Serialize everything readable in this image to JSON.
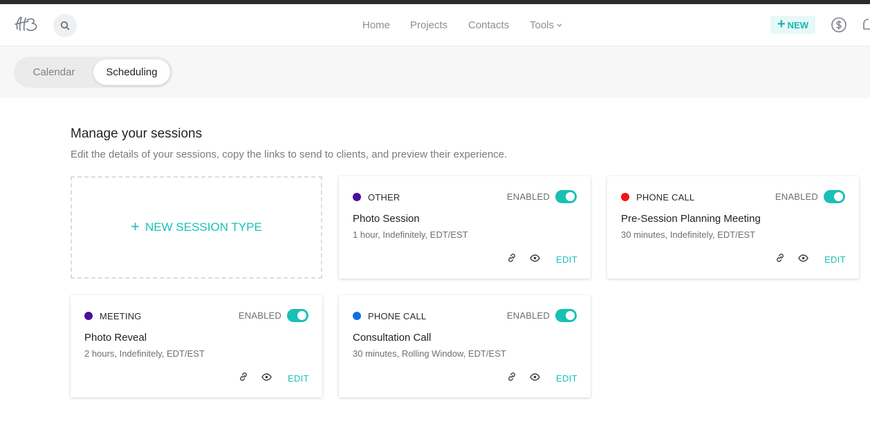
{
  "header": {
    "nav": {
      "home": "Home",
      "projects": "Projects",
      "contacts": "Contacts",
      "tools": "Tools"
    },
    "new_button": "NEW",
    "accent_color": "#19c0b5"
  },
  "tabs": {
    "calendar": "Calendar",
    "scheduling": "Scheduling",
    "active": "Scheduling"
  },
  "main": {
    "title": "Manage your sessions",
    "subtitle": "Edit the details of your sessions, copy the links to send to clients, and preview their experience.",
    "new_session_label": "NEW SESSION TYPE"
  },
  "sessions": [
    {
      "type": "OTHER",
      "dot_color": "#4b0f9c",
      "status": "ENABLED",
      "enabled": true,
      "title": "Photo Session",
      "meta": "1 hour, Indefinitely, EDT/EST",
      "edit": "EDIT"
    },
    {
      "type": "PHONE CALL",
      "dot_color": "#f01414",
      "status": "ENABLED",
      "enabled": true,
      "title": "Pre-Session Planning Meeting",
      "meta": "30 minutes, Indefinitely, EDT/EST",
      "edit": "EDIT"
    },
    {
      "type": "MEETING",
      "dot_color": "#4b0f9c",
      "status": "ENABLED",
      "enabled": true,
      "title": "Photo Reveal",
      "meta": "2 hours, Indefinitely, EDT/EST",
      "edit": "EDIT"
    },
    {
      "type": "PHONE CALL",
      "dot_color": "#0f6fe6",
      "status": "ENABLED",
      "enabled": true,
      "title": "Consultation Call",
      "meta": "30 minutes, Rolling Window, EDT/EST",
      "edit": "EDIT"
    }
  ]
}
